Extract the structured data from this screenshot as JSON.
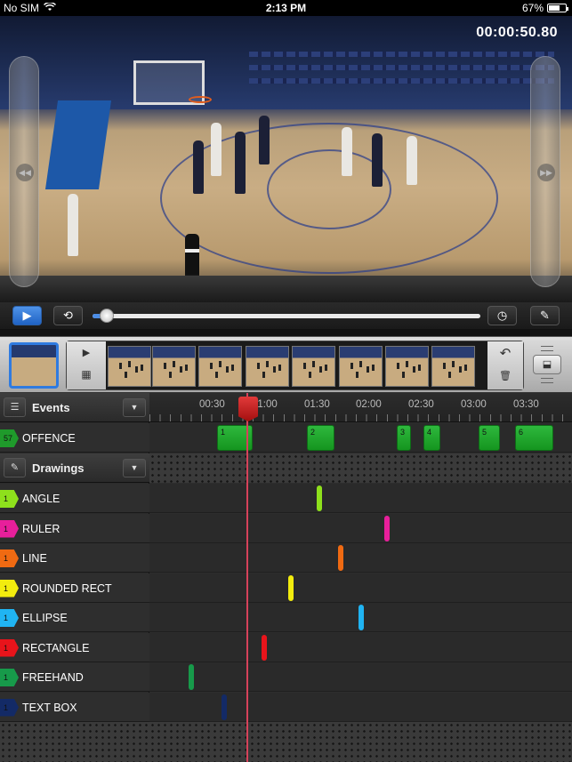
{
  "status_bar": {
    "carrier": "No SIM",
    "time": "2:13 PM",
    "battery": "67%",
    "battery_fraction": 0.67
  },
  "video": {
    "timecode": "00:00:50.80"
  },
  "transport": {
    "play_icon": "▶",
    "loop_icon": "⟲",
    "clock_icon": "◷",
    "pen_icon": "✎",
    "progress": 0.04
  },
  "filmstrip": {
    "play_icon": "▶",
    "film_icon": "▦",
    "undo_icon": "↶",
    "trash_icon": "🗑",
    "side_icon": "⬓"
  },
  "timeline": {
    "ticks": [
      "00:30",
      "01:00",
      "01:30",
      "02:00",
      "02:30",
      "03:00",
      "03:30"
    ]
  },
  "events_group": {
    "icon": "☰",
    "title": "Events",
    "dropdown": "▼"
  },
  "offence_row": {
    "count": "57",
    "name": "OFFENCE",
    "color": "#1f9a2b",
    "blocks": [
      "1",
      "2",
      "3",
      "4",
      "5",
      "6"
    ]
  },
  "drawings_group": {
    "icon": "✎",
    "title": "Drawings",
    "dropdown": "▼"
  },
  "drawing_rows": [
    {
      "count": "1",
      "name": "ANGLE",
      "color": "#8ee01c"
    },
    {
      "count": "1",
      "name": "RULER",
      "color": "#e81f9b"
    },
    {
      "count": "1",
      "name": "LINE",
      "color": "#f06a12"
    },
    {
      "count": "1",
      "name": "ROUNDED RECT",
      "color": "#f2ec0e"
    },
    {
      "count": "1",
      "name": "ELLIPSE",
      "color": "#20b4f2"
    },
    {
      "count": "1",
      "name": "RECTANGLE",
      "color": "#e8141b"
    },
    {
      "count": "1",
      "name": "FREEHAND",
      "color": "#179a4a"
    },
    {
      "count": "1",
      "name": "TEXT BOX",
      "color": "#132a66"
    }
  ]
}
